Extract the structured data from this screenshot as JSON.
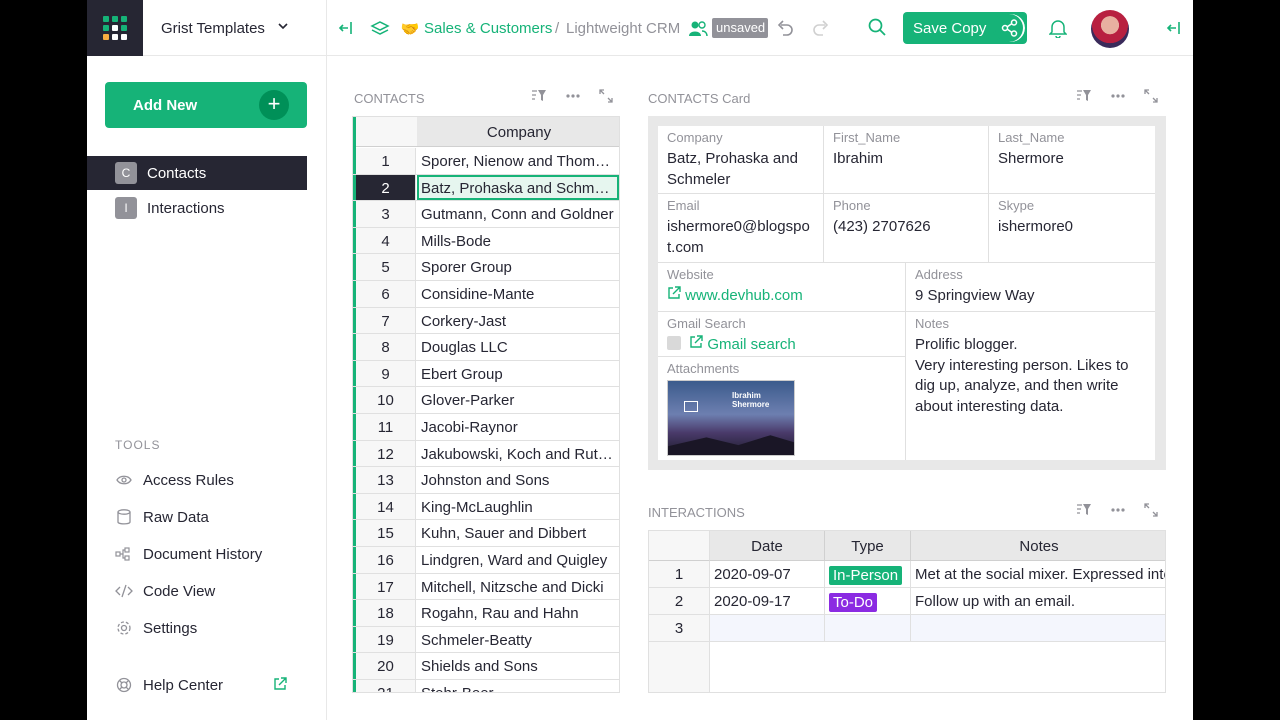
{
  "topbar": {
    "org_name": "Grist Templates",
    "workspace": "Sales & Customers",
    "breadcrumb_sep": "/",
    "doc_name": "Lightweight CRM",
    "unsaved_label": "unsaved",
    "save_copy_label": "Save Copy"
  },
  "colors": {
    "accent": "#16b378",
    "dark": "#262633",
    "muted": "#929299"
  },
  "sidebar": {
    "add_new_label": "Add New",
    "add_new_plus": "+",
    "pages": [
      {
        "badge": "C",
        "label": "Contacts",
        "active": true
      },
      {
        "badge": "I",
        "label": "Interactions",
        "active": false
      }
    ],
    "tools_label": "TOOLS",
    "tools": [
      {
        "icon": "eye-icon",
        "label": "Access Rules"
      },
      {
        "icon": "database-icon",
        "label": "Raw Data"
      },
      {
        "icon": "history-icon",
        "label": "Document History"
      },
      {
        "icon": "code-icon",
        "label": "Code View"
      },
      {
        "icon": "gear-icon",
        "label": "Settings"
      }
    ],
    "help_label": "Help Center"
  },
  "contacts": {
    "title": "CONTACTS",
    "column": "Company",
    "selected_row": 2,
    "rows": [
      "Sporer, Nienow and Thompson",
      "Batz, Prohaska and Schmeler",
      "Gutmann, Conn and Goldner",
      "Mills-Bode",
      "Sporer Group",
      "Considine-Mante",
      "Corkery-Jast",
      "Douglas LLC",
      "Ebert Group",
      "Glover-Parker",
      "Jacobi-Raynor",
      "Jakubowski, Koch and Rutherford",
      "Johnston and Sons",
      "King-McLaughlin",
      "Kuhn, Sauer and Dibbert",
      "Lindgren, Ward and Quigley",
      "Mitchell, Nitzsche and Dicki",
      "Rogahn, Rau and Hahn",
      "Schmeler-Beatty",
      "Shields and Sons",
      "Stehr-Beer"
    ]
  },
  "card": {
    "title": "CONTACTS Card",
    "company_label": "Company",
    "company": "Batz, Prohaska and Schmeler",
    "first_name_label": "First_Name",
    "first_name": "Ibrahim",
    "last_name_label": "Last_Name",
    "last_name": "Shermore",
    "email_label": "Email",
    "email": "ishermore0@blogspot.com",
    "phone_label": "Phone",
    "phone": "(423) 2707626",
    "skype_label": "Skype",
    "skype": "ishermore0",
    "website_label": "Website",
    "website": "www.devhub.com",
    "address_label": "Address",
    "address": "9 Springview Way",
    "gmail_label": "Gmail Search",
    "gmail": "Gmail search",
    "notes_label": "Notes",
    "notes_line1": "Prolific blogger.",
    "notes_line2": "Very interesting person. Likes to dig up, analyze, and then write about interesting data.",
    "attachments_label": "Attachments",
    "attachment_name": "Ibrahim Shermore"
  },
  "interactions": {
    "title": "INTERACTIONS",
    "columns": [
      "Date",
      "Type",
      "Notes"
    ],
    "rows": [
      {
        "num": "1",
        "date": "2020-09-07",
        "type": "In-Person",
        "type_color": "#16b378",
        "notes": "Met at the social mixer. Expressed interest."
      },
      {
        "num": "2",
        "date": "2020-09-17",
        "type": "To-Do",
        "type_color": "#8b2be2",
        "notes": "Follow up with an email."
      },
      {
        "num": "3",
        "date": "",
        "type": "",
        "type_color": "",
        "notes": ""
      }
    ]
  }
}
